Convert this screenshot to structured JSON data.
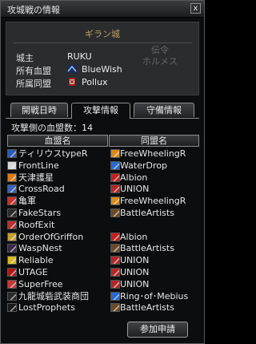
{
  "window": {
    "title": "攻城戦の情報",
    "close_glyph": "x"
  },
  "castle": {
    "name": "ギラン城",
    "watermark_line1": "伝令",
    "watermark_line2": "ホルメス",
    "lord_label": "城主",
    "lord_value": "RUKU",
    "clan_label": "所有血盟",
    "clan_value": "BlueWish",
    "alliance_label": "所属同盟",
    "alliance_value": "Pollux"
  },
  "tabs": [
    {
      "label": "開戦日時",
      "active": false
    },
    {
      "label": "攻撃情報",
      "active": true
    },
    {
      "label": "守備情報",
      "active": false
    }
  ],
  "attack": {
    "count_text": "攻撃側の血盟数：14",
    "col_clan": "血盟名",
    "col_alliance": "同盟名",
    "rows": [
      {
        "clan": "ティリウスtypeR",
        "alliance": "FreeWheelingR",
        "clan_icon": "#2b5bb5",
        "ally_icon": "#d98a1a"
      },
      {
        "clan": "FrontLine",
        "alliance": "WaterDrop",
        "clan_icon": "#d8d8d8",
        "ally_icon": "#2a6ad0"
      },
      {
        "clan": "天津護星",
        "alliance": "Albion",
        "clan_icon": "#e07a18",
        "ally_icon": "#c02020"
      },
      {
        "clan": "CrossRoad",
        "alliance": "UNION",
        "clan_icon": "#3a62b8",
        "ally_icon": "#b02828"
      },
      {
        "clan": "亀軍",
        "alliance": "FreeWheelingR",
        "clan_icon": "#c93030",
        "ally_icon": "#d98a1a"
      },
      {
        "clan": "FakeStars",
        "alliance": "BattleArtists",
        "clan_icon": "#2a2a2a",
        "ally_icon": "#6a4a2a"
      },
      {
        "clan": "RoofExit",
        "alliance": "",
        "clan_icon": "#b83030",
        "ally_icon": ""
      },
      {
        "clan": "OrderOfGriffon",
        "alliance": "Albion",
        "clan_icon": "#c8a030",
        "ally_icon": "#c02020"
      },
      {
        "clan": "WaspNest",
        "alliance": "BattleArtists",
        "clan_icon": "#3a2a4a",
        "ally_icon": "#6a4a2a"
      },
      {
        "clan": "Reliable",
        "alliance": "UNION",
        "clan_icon": "#d8b820",
        "ally_icon": "#b02828"
      },
      {
        "clan": "UTAGE",
        "alliance": "UNION",
        "clan_icon": "#b01818",
        "ally_icon": "#b02828"
      },
      {
        "clan": "SuperFree",
        "alliance": "UNION",
        "clan_icon": "#c83838",
        "ally_icon": "#b02828"
      },
      {
        "clan": "九龍城砦武装商団",
        "alliance": "Ring･of･Mebius",
        "clan_icon": "#2a2a2a",
        "ally_icon": "#2a6ad0"
      },
      {
        "clan": "LostProphets",
        "alliance": "BattleArtists",
        "clan_icon": "#1a1a1a",
        "ally_icon": "#6a4a2a"
      }
    ]
  },
  "apply_button": "参加申請"
}
